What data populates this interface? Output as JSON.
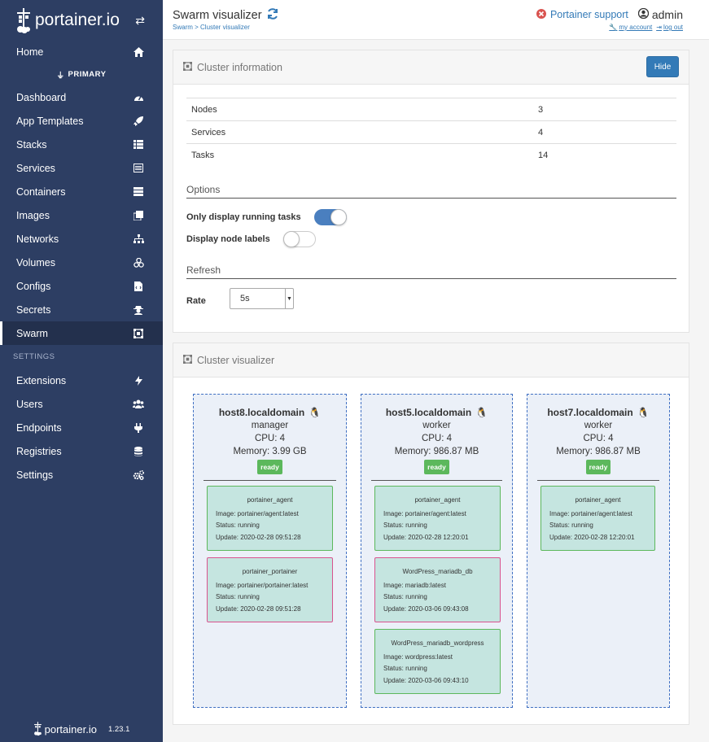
{
  "brand": {
    "name": "portainer.io",
    "version": "1.23.1"
  },
  "sidebar": {
    "home": "Home",
    "endpoint": "PRIMARY",
    "items": [
      "Dashboard",
      "App Templates",
      "Stacks",
      "Services",
      "Containers",
      "Images",
      "Networks",
      "Volumes",
      "Configs",
      "Secrets",
      "Swarm"
    ],
    "settings_header": "SETTINGS",
    "settings_items": [
      "Extensions",
      "Users",
      "Endpoints",
      "Registries",
      "Settings"
    ]
  },
  "header": {
    "title": "Swarm visualizer",
    "breadcrumb": "Swarm > Cluster visualizer",
    "support": "Portainer support",
    "user": "admin",
    "my_account": "my account",
    "log_out": "log out"
  },
  "cluster_info": {
    "title": "Cluster information",
    "hide_label": "Hide",
    "rows": [
      {
        "label": "Nodes",
        "value": "3"
      },
      {
        "label": "Services",
        "value": "4"
      },
      {
        "label": "Tasks",
        "value": "14"
      }
    ],
    "options_title": "Options",
    "option_running": "Only display running tasks",
    "option_running_on": true,
    "option_labels": "Display node labels",
    "option_labels_on": false,
    "refresh_title": "Refresh",
    "rate_label": "Rate",
    "rate_value": "5s"
  },
  "visualizer": {
    "title": "Cluster visualizer",
    "nodes": [
      {
        "name": "host8.localdomain",
        "role": "manager",
        "cpu": "CPU: 4",
        "memory": "Memory: 3.99 GB",
        "status": "ready",
        "tasks": [
          {
            "name": "portainer_agent",
            "image": "Image: portainer/agent:latest",
            "status": "Status: running",
            "update": "Update: 2020-02-28 09:51:28"
          },
          {
            "name": "portainer_portainer",
            "image": "Image: portainer/portainer:latest",
            "status": "Status: running",
            "update": "Update: 2020-02-28 09:51:28"
          }
        ]
      },
      {
        "name": "host5.localdomain",
        "role": "worker",
        "cpu": "CPU: 4",
        "memory": "Memory: 986.87 MB",
        "status": "ready",
        "tasks": [
          {
            "name": "portainer_agent",
            "image": "Image: portainer/agent:latest",
            "status": "Status: running",
            "update": "Update: 2020-02-28 12:20:01"
          },
          {
            "name": "WordPress_mariadb_db",
            "image": "Image: mariadb:latest",
            "status": "Status: running",
            "update": "Update: 2020-03-06 09:43:08"
          },
          {
            "name": "WordPress_mariadb_wordpress",
            "image": "Image: wordpress:latest",
            "status": "Status: running",
            "update": "Update: 2020-03-06 09:43:10"
          }
        ]
      },
      {
        "name": "host7.localdomain",
        "role": "worker",
        "cpu": "CPU: 4",
        "memory": "Memory: 986.87 MB",
        "status": "ready",
        "tasks": [
          {
            "name": "portainer_agent",
            "image": "Image: portainer/agent:latest",
            "status": "Status: running",
            "update": "Update: 2020-02-28 12:20:01"
          }
        ]
      }
    ]
  }
}
